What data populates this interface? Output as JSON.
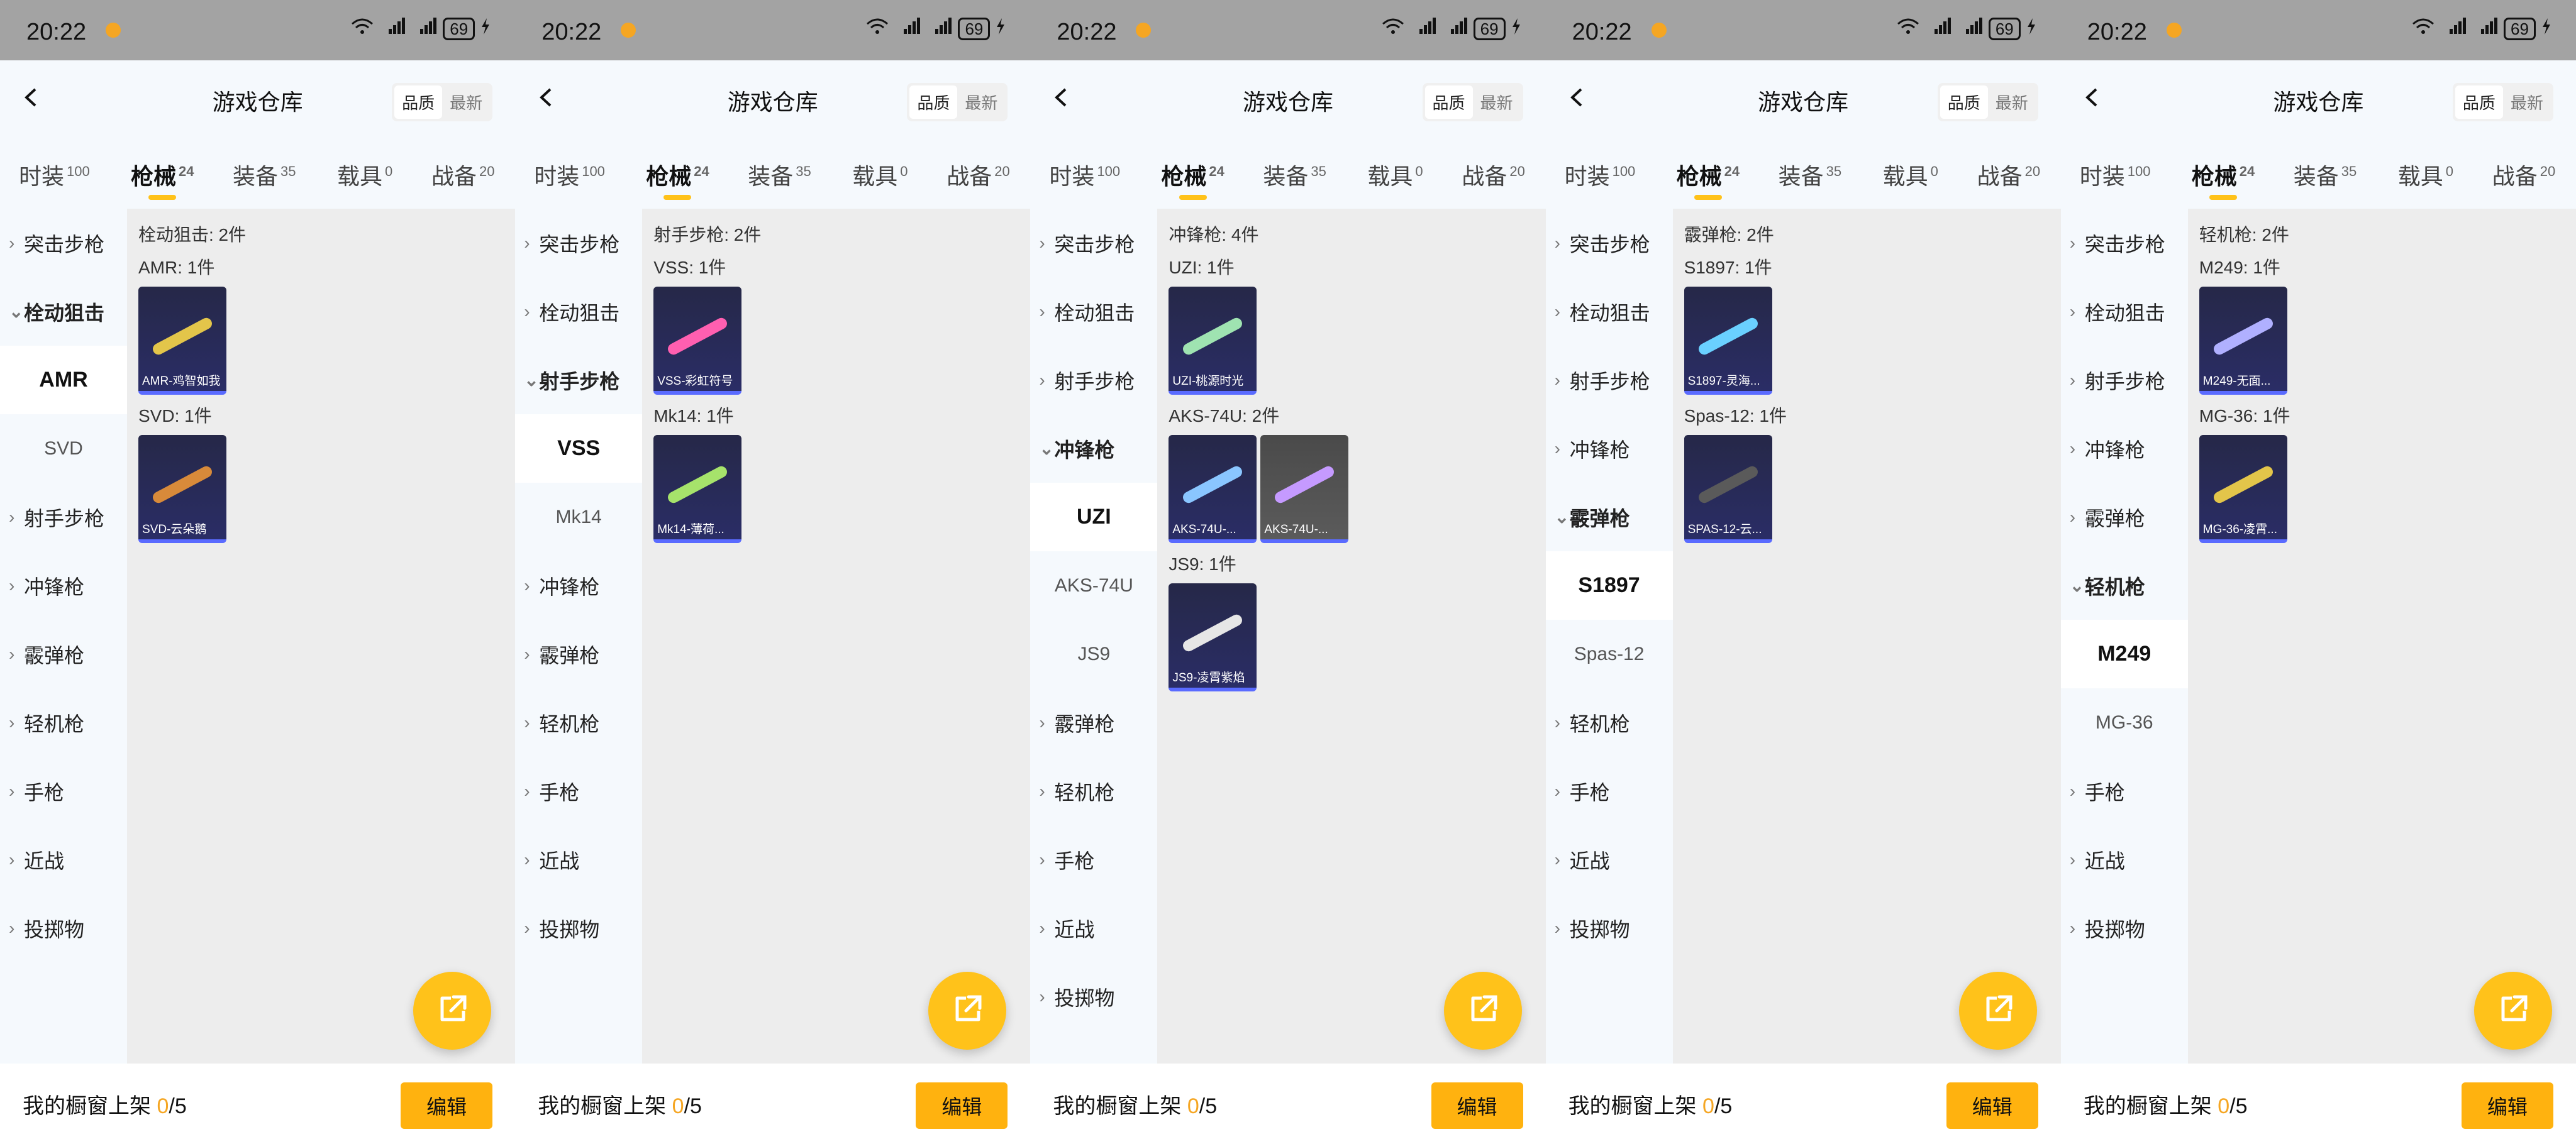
{
  "status": {
    "time": "20:22",
    "battery": "69"
  },
  "header": {
    "title": "游戏仓库",
    "sort_quality": "品质",
    "sort_latest": "最新"
  },
  "tabs": [
    {
      "label": "时装",
      "count": "100"
    },
    {
      "label": "枪械",
      "count": "24"
    },
    {
      "label": "装备",
      "count": "35"
    },
    {
      "label": "载具",
      "count": "0"
    },
    {
      "label": "战备",
      "count": "20"
    }
  ],
  "categories": [
    "突击步枪",
    "栓动狙击",
    "射手步枪",
    "冲锋枪",
    "霰弹枪",
    "轻机枪",
    "手枪",
    "近战",
    "投掷物"
  ],
  "bottom": {
    "label": "我的橱窗上架 ",
    "count": "0",
    "total": "/5",
    "edit": "编辑"
  },
  "colors": {
    "accent": "#ffc21a",
    "edit_button": "#ffb20f",
    "highlight": "#f5a623",
    "card_dark": "#2a2d66"
  },
  "icons": {
    "back": "chevron-left-icon",
    "share": "share-arrow-icon",
    "chevron": "chevron-right-icon",
    "chevron_down": "chevron-down-icon"
  },
  "screens": [
    {
      "expanded": "栓动狙击",
      "subitems": [
        "AMR",
        "SVD"
      ],
      "active_sub": "AMR",
      "group_title": "栓动狙击: 2件",
      "weapons": [
        {
          "label": "AMR: 1件",
          "skins": [
            {
              "name": "AMR-鸡智如我",
              "style": "normal"
            }
          ]
        },
        {
          "label": "SVD: 1件",
          "skins": [
            {
              "name": "SVD-云朵鹅",
              "style": "normal"
            }
          ]
        }
      ]
    },
    {
      "expanded": "射手步枪",
      "subitems": [
        "VSS",
        "Mk14"
      ],
      "active_sub": "VSS",
      "group_title": "射手步枪: 2件",
      "weapons": [
        {
          "label": "VSS: 1件",
          "skins": [
            {
              "name": "VSS-彩虹符号",
              "style": "normal"
            }
          ]
        },
        {
          "label": "Mk14: 1件",
          "skins": [
            {
              "name": "Mk14-薄荷...",
              "style": "normal"
            }
          ]
        }
      ]
    },
    {
      "expanded": "冲锋枪",
      "subitems": [
        "UZI",
        "AKS-74U",
        "JS9"
      ],
      "active_sub": "UZI",
      "group_title": "冲锋枪: 4件",
      "weapons": [
        {
          "label": "UZI: 1件",
          "skins": [
            {
              "name": "UZI-桃源时光",
              "style": "normal"
            }
          ]
        },
        {
          "label": "AKS-74U: 2件",
          "skins": [
            {
              "name": "AKS-74U-...",
              "style": "normal"
            },
            {
              "name": "AKS-74U-...",
              "style": "grey"
            }
          ]
        },
        {
          "label": "JS9: 1件",
          "skins": [
            {
              "name": "JS9-凌霄紫焰",
              "style": "normal"
            }
          ]
        }
      ]
    },
    {
      "expanded": "霰弹枪",
      "subitems": [
        "S1897",
        "Spas-12"
      ],
      "active_sub": "S1897",
      "group_title": "霰弹枪: 2件",
      "weapons": [
        {
          "label": "S1897: 1件",
          "skins": [
            {
              "name": "S1897-灵海...",
              "style": "normal"
            }
          ]
        },
        {
          "label": "Spas-12: 1件",
          "skins": [
            {
              "name": "SPAS-12-云...",
              "style": "normal"
            }
          ]
        }
      ]
    },
    {
      "expanded": "轻机枪",
      "subitems": [
        "M249",
        "MG-36"
      ],
      "active_sub": "M249",
      "group_title": "轻机枪: 2件",
      "weapons": [
        {
          "label": "M249: 1件",
          "skins": [
            {
              "name": "M249-无面...",
              "style": "normal"
            }
          ]
        },
        {
          "label": "MG-36: 1件",
          "skins": [
            {
              "name": "MG-36-凌霄...",
              "style": "normal"
            }
          ]
        }
      ]
    }
  ]
}
